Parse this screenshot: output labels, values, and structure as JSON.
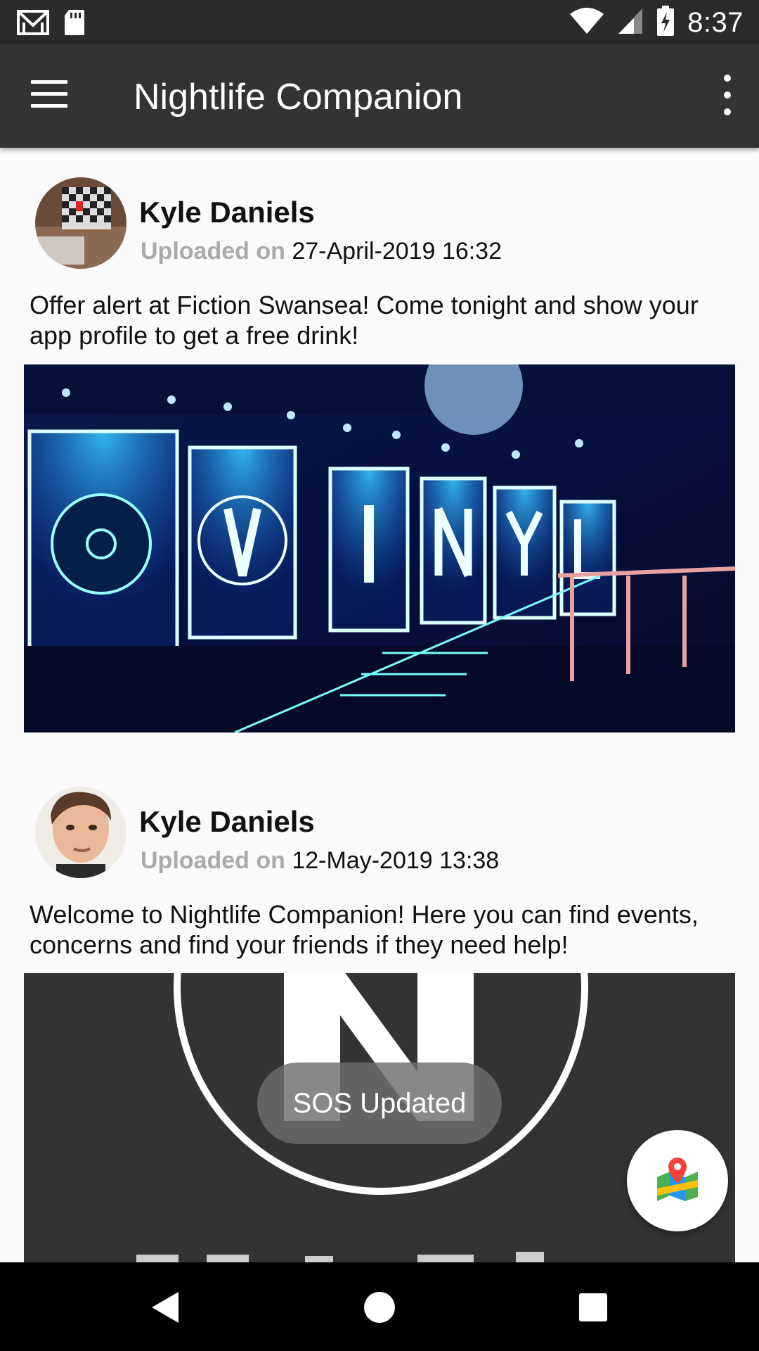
{
  "status_bar": {
    "time": "8:37",
    "icons": [
      "gmail-icon",
      "sd-card-icon",
      "wifi-icon",
      "cell-signal-icon",
      "battery-charging-icon"
    ]
  },
  "app_bar": {
    "title": "Nightlife Companion",
    "menu_icon": "hamburger-menu-icon",
    "overflow_icon": "more-vert-icon"
  },
  "posts": [
    {
      "author": "Kyle Daniels",
      "uploaded_label": "Uploaded on",
      "date": "27-April-2019 16:32",
      "text": "Offer alert at Fiction Swansea! Come tonight and show your app profile to get a free drink!",
      "image": "vinyl-club-stage-photo"
    },
    {
      "author": "Kyle Daniels",
      "uploaded_label": "Uploaded on",
      "date": "12-May-2019 13:38",
      "text": "Welcome to Nightlife Companion! Here you can find events, concerns and find your friends if they need help!",
      "image": "nightlife-companion-logo"
    }
  ],
  "toast": {
    "message": "SOS Updated"
  },
  "fab": {
    "icon": "maps-pin-icon"
  },
  "nav_bar": {
    "icons": [
      "back-icon",
      "home-icon",
      "recents-icon"
    ]
  },
  "colors": {
    "app_bar": "#333333",
    "status_bar": "#2b2b2b",
    "background": "#fafafa",
    "upload_label": "#aaaaaa"
  }
}
